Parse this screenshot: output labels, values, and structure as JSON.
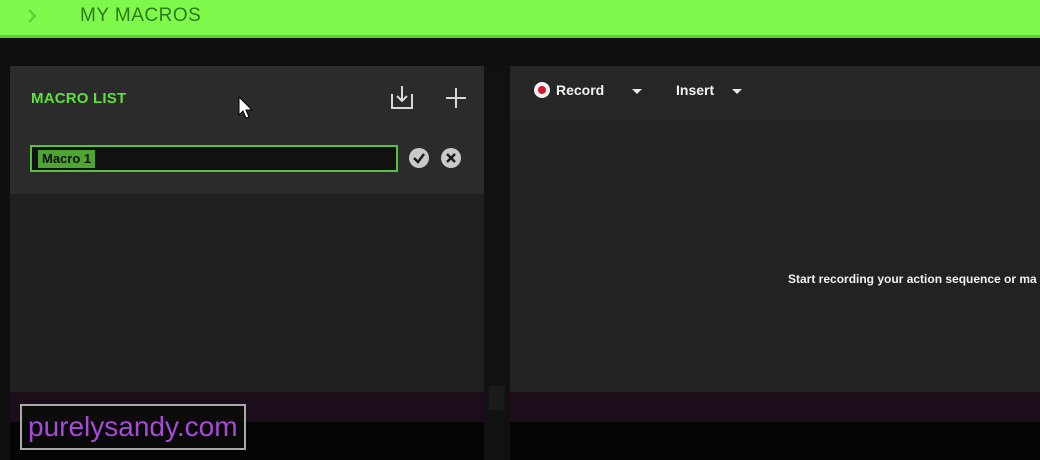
{
  "header": {
    "title": "MY MACROS"
  },
  "macro_list": {
    "title": "MACRO LIST",
    "editing_value": "Macro 1"
  },
  "toolbar": {
    "record_label": "Record",
    "insert_label": "Insert"
  },
  "editor": {
    "hint_text": "Start recording your action sequence or ma"
  },
  "watermark": {
    "text": "purelysandy.com"
  },
  "colors": {
    "accent_green": "#7ef84a",
    "record_red": "#d4182e",
    "watermark_purple": "#a64bd6"
  }
}
